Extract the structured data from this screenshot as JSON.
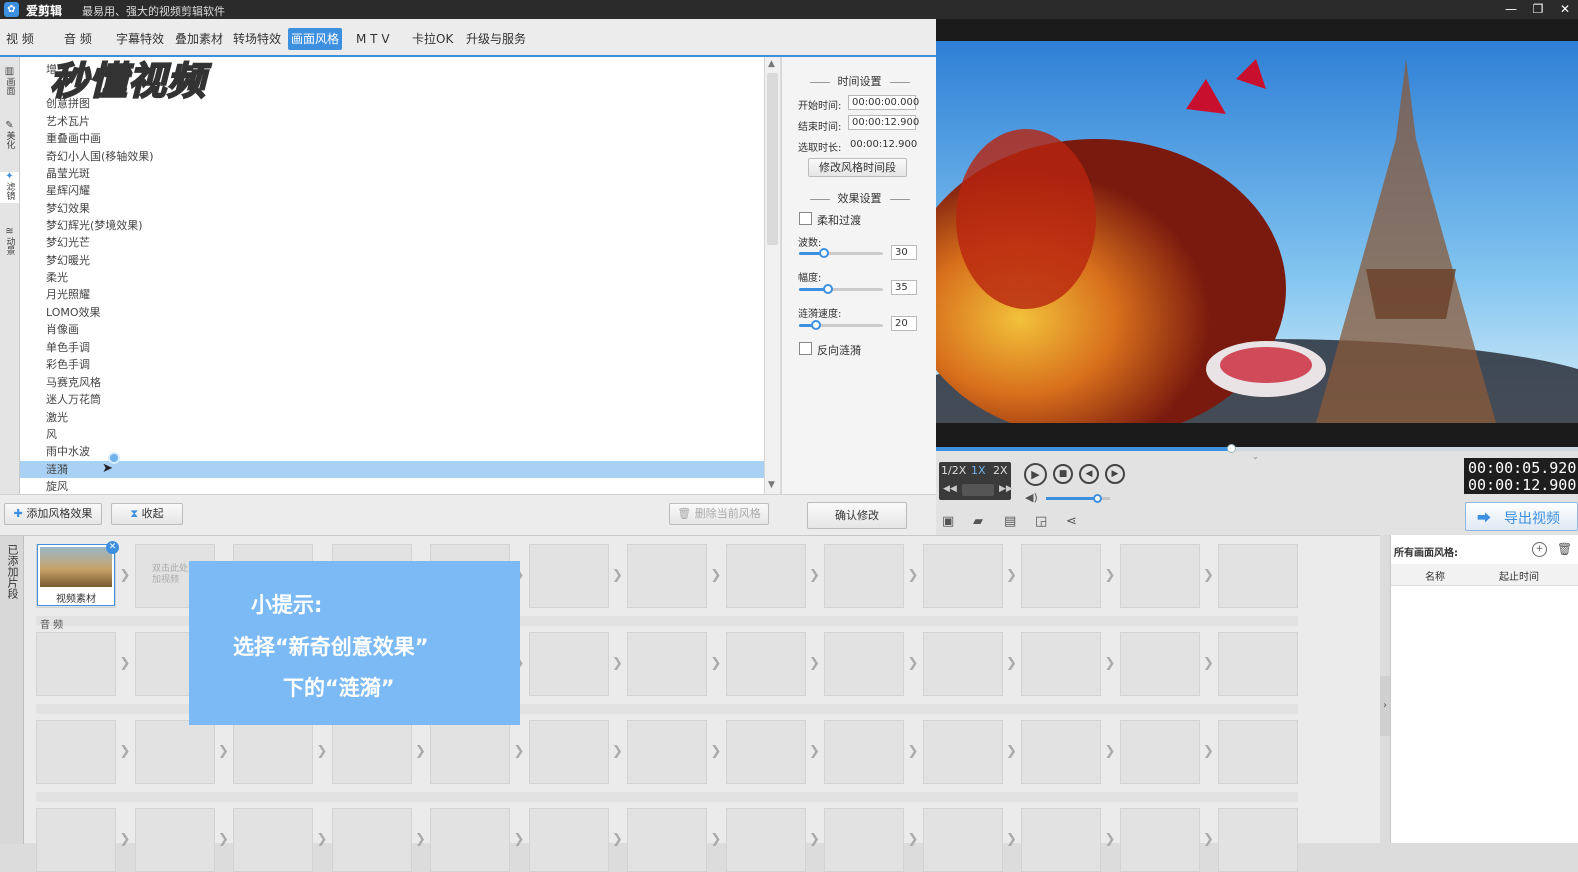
{
  "app": {
    "name": "爱剪辑",
    "slogan": "最易用、强大的视频剪辑软件"
  },
  "tabs": [
    {
      "label": "视  频"
    },
    {
      "label": "音  频"
    },
    {
      "label": "字幕特效"
    },
    {
      "label": "叠加素材"
    },
    {
      "label": "转场特效"
    },
    {
      "label": "画面风格"
    },
    {
      "label": "M T V"
    },
    {
      "label": "卡拉OK"
    },
    {
      "label": "升级与服务"
    }
  ],
  "side_tabs": [
    {
      "label": "画面"
    },
    {
      "label": "美化"
    },
    {
      "label": "滤镜"
    },
    {
      "label": "动景"
    }
  ],
  "watermark": "秒懂视频",
  "effects": [
    {
      "label": "增"
    },
    {
      "label": "创意拼图"
    },
    {
      "label": "艺术瓦片"
    },
    {
      "label": "重叠画中画"
    },
    {
      "label": "奇幻小人国(移轴效果)"
    },
    {
      "label": "晶莹光斑"
    },
    {
      "label": "星辉闪耀"
    },
    {
      "label": "梦幻效果"
    },
    {
      "label": "梦幻辉光(梦境效果)"
    },
    {
      "label": "梦幻光芒"
    },
    {
      "label": "梦幻暖光"
    },
    {
      "label": "柔光"
    },
    {
      "label": "月光照耀"
    },
    {
      "label": "LOMO效果"
    },
    {
      "label": "肖像画"
    },
    {
      "label": "单色手调"
    },
    {
      "label": "彩色手调"
    },
    {
      "label": "马赛克风格"
    },
    {
      "label": "迷人万花筒"
    },
    {
      "label": "激光"
    },
    {
      "label": "风"
    },
    {
      "label": "雨中水波"
    },
    {
      "label": "涟漪"
    },
    {
      "label": "旋风"
    }
  ],
  "selected_effect": "涟漪",
  "settings": {
    "time_title": "时间设置",
    "start_label": "开始时间:",
    "start_value": "00:00:00.000",
    "end_label": "结束时间:",
    "end_value": "00:00:12.900",
    "dur_label": "选取时长:",
    "dur_value": "00:00:12.900",
    "modify_time_btn": "修改风格时间段",
    "effect_title": "效果设置",
    "soft_transition": "柔和过渡",
    "wave_label": "波数:",
    "wave_value": "30",
    "wave_level": 0.3,
    "amp_label": "幅度:",
    "amp_value": "35",
    "amp_level": 0.35,
    "speed_label": "涟漪速度:",
    "speed_value": "20",
    "speed_level": 0.2,
    "reverse": "反向涟漪"
  },
  "actions": {
    "add_effect": "添加风格效果",
    "collapse": "收起",
    "delete_current": "删除当前风格",
    "confirm": "确认修改"
  },
  "player": {
    "speed_half": "1/2X",
    "speed_1x": "1X",
    "speed_2x": "2X",
    "current_time": "00:00:05.920",
    "total_time": "00:00:12.900",
    "export": "导出视频",
    "progress": 0.46,
    "volume": 0.8
  },
  "timeline": {
    "side_label": "已添加片段",
    "clip_label": "视频素材",
    "empty_hint": "双击此处添加视频",
    "audio_label": "音  频"
  },
  "style_panel": {
    "title": "所有画面风格:",
    "col_name": "名称",
    "col_time": "起止时间"
  },
  "tip": {
    "title": "小提示:",
    "line1": "选择“新奇创意效果”",
    "line2": "下的“涟漪”"
  },
  "colors": {
    "accent": "#3d8fe0",
    "selected_row": "#a9d1f5",
    "tip_bg": "#7cbaf6"
  }
}
